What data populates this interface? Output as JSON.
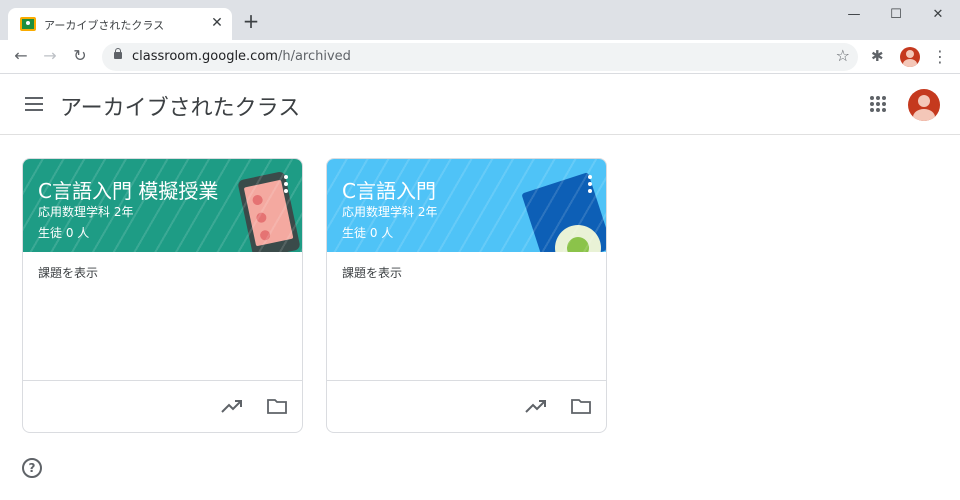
{
  "browser": {
    "tab_title": "アーカイブされたクラス",
    "tab_close": "✕",
    "new_tab": "+",
    "url_host": "classroom.google.com",
    "url_path": "/h/archived",
    "window_controls": {
      "minimize": "—",
      "maximize": "☐",
      "close": "✕"
    },
    "icons": [
      "back-icon",
      "forward-icon",
      "reload-icon",
      "lock-icon",
      "star-icon",
      "extensions-icon",
      "menu-dots-icon"
    ]
  },
  "header": {
    "title": "アーカイブされたクラス"
  },
  "cards": [
    {
      "title": "C言語入門 模擬授業",
      "subtitle": "応用数理学科 2年",
      "students": "生徒 0 人",
      "body_link": "課題を表示",
      "banner_color": "#1e9c85"
    },
    {
      "title": "C言語入門",
      "subtitle": "応用数理学科 2年",
      "students": "生徒 0 人",
      "body_link": "課題を表示",
      "banner_color": "#4fc3f7"
    }
  ],
  "help": {
    "icon": "help-icon",
    "label": "?"
  }
}
